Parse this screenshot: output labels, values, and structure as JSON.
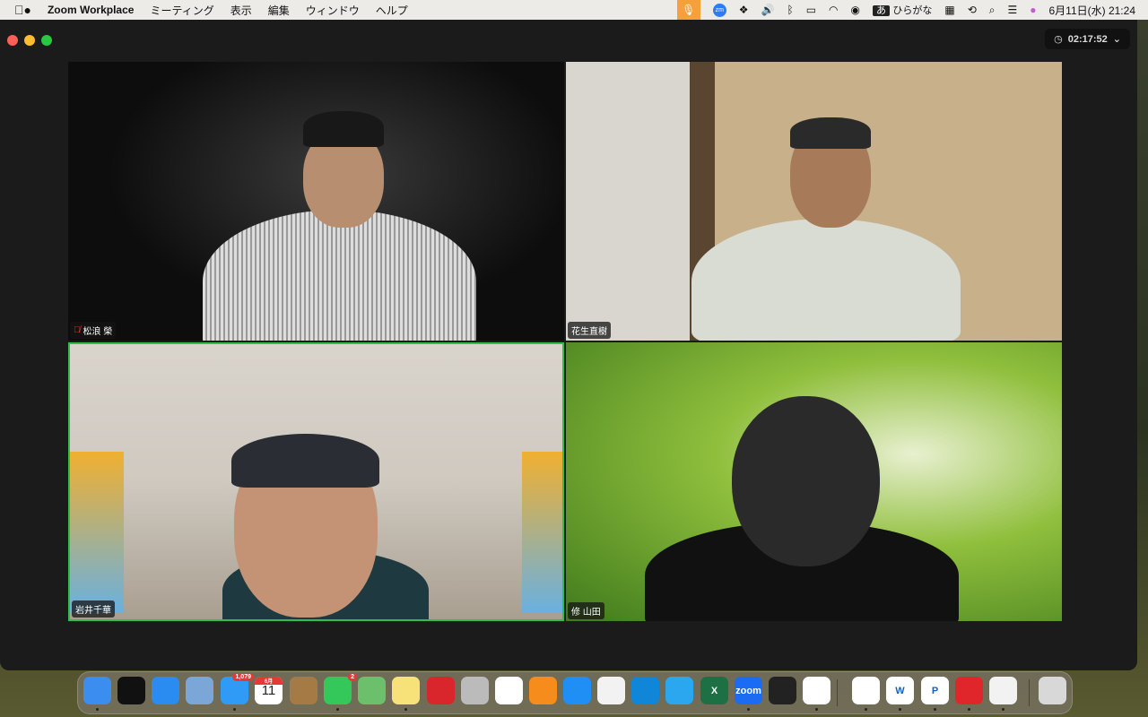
{
  "menubar": {
    "app": "Zoom Workplace",
    "items": [
      "ミーティング",
      "表示",
      "編集",
      "ウィンドウ",
      "ヘルプ"
    ],
    "ime_badge": "あ",
    "ime_label": "ひらがな",
    "datetime": "6月11日(水) 21:24",
    "zoom_icon_label": "zm"
  },
  "meeting": {
    "timer": "02:17:52"
  },
  "participants": [
    {
      "name": "松浪 榮",
      "muted": true
    },
    {
      "name": "花生直樹",
      "muted": false
    },
    {
      "name": "岩井千華",
      "muted": false,
      "active_speaker": true
    },
    {
      "name": "修 山田",
      "muted": false
    }
  ],
  "dock": {
    "items": [
      {
        "name": "finder",
        "color": "#3b8ef0",
        "running": true
      },
      {
        "name": "mission-control",
        "color": "#111"
      },
      {
        "name": "safari",
        "color": "#2a8cf0"
      },
      {
        "name": "preview",
        "color": "#7aa7d8"
      },
      {
        "name": "mail",
        "color": "#2f9bf7",
        "badge": "1,079",
        "running": true
      },
      {
        "name": "calendar",
        "color": "#ffffff",
        "label": "11",
        "sub": "6月"
      },
      {
        "name": "contacts",
        "color": "#a57a45"
      },
      {
        "name": "messages",
        "color": "#34c759",
        "badge": "2",
        "running": true
      },
      {
        "name": "maps",
        "color": "#6cc06c"
      },
      {
        "name": "notes",
        "color": "#f7e27a",
        "running": true
      },
      {
        "name": "photo-booth",
        "color": "#d8262c"
      },
      {
        "name": "launchpad",
        "color": "#bbbbbb"
      },
      {
        "name": "photos",
        "color": "#ffffff"
      },
      {
        "name": "books",
        "color": "#f58c1b"
      },
      {
        "name": "app-store",
        "color": "#1f8ef5"
      },
      {
        "name": "reminders",
        "color": "#f2f2f2"
      },
      {
        "name": "skype",
        "color": "#0f86d8"
      },
      {
        "name": "skype-2",
        "color": "#2aa7ee"
      },
      {
        "name": "excel",
        "color": "#1d7044",
        "label": "X"
      },
      {
        "name": "zoom",
        "color": "#1b6cf2",
        "label": "zoom",
        "running": true
      },
      {
        "name": "prism",
        "color": "#222"
      },
      {
        "name": "messenger",
        "color": "#ffffff",
        "running": true
      },
      {
        "name": "chrome",
        "color": "#ffffff",
        "running": true
      },
      {
        "name": "word",
        "color": "#ffffff",
        "label": "W",
        "running": true
      },
      {
        "name": "powerpoint",
        "color": "#ffffff",
        "label": "P",
        "running": true
      },
      {
        "name": "trend-micro",
        "color": "#e0262a",
        "running": true
      },
      {
        "name": "printer",
        "color": "#f2f2f2",
        "running": true
      },
      {
        "name": "trash",
        "color": "#d8d8d8"
      }
    ]
  }
}
